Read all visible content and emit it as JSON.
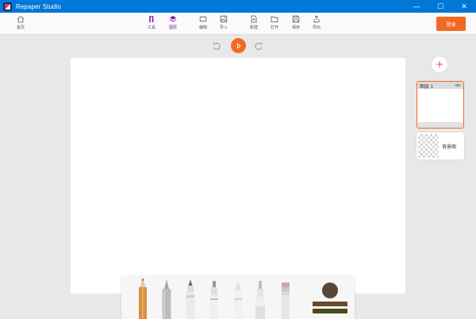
{
  "window": {
    "title": "Repaper Studio",
    "controls": [
      "—",
      "☐",
      "✕"
    ]
  },
  "toolbar": {
    "home": "首页",
    "tools": "工具",
    "layers": "图层",
    "crop": "编辑",
    "import": "导入",
    "new": "新建",
    "open": "打开",
    "save": "保存",
    "export": "导出",
    "login": "登录"
  },
  "layers": {
    "layer1_name": "图层 1",
    "background_name": "背景图"
  },
  "colors": {
    "accent": "#f26a21",
    "titlebar": "#0078d7",
    "active_tab": "#7b1fa2",
    "current_color": "#5a4638",
    "bar_top": "#6a4a2e",
    "bar_bottom": "#4a4a1a"
  },
  "brushes": [
    "pencil",
    "marker-gray",
    "pen",
    "highlighter",
    "crayon",
    "airbrush",
    "eraser"
  ]
}
